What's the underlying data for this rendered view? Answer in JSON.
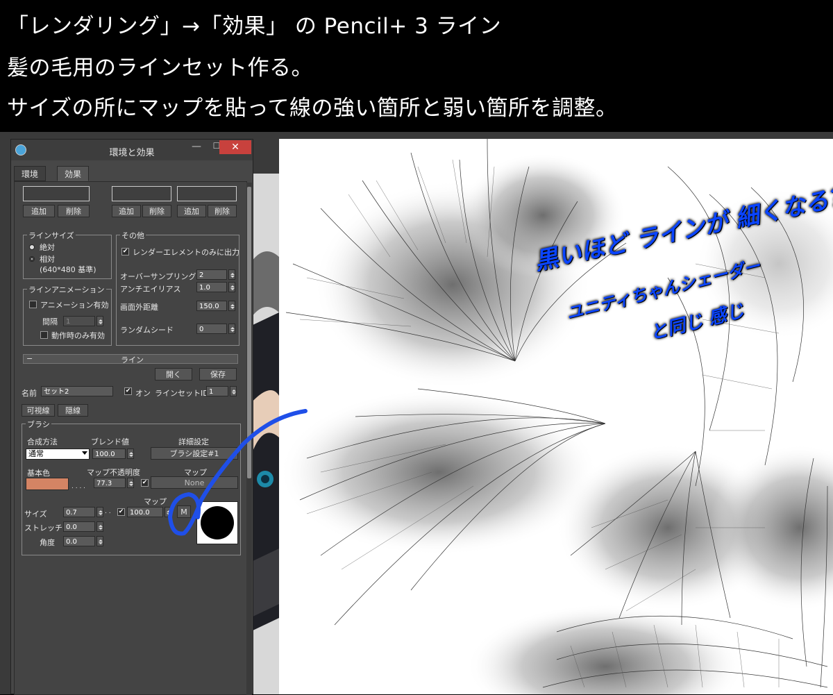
{
  "banner": {
    "line1": "「レンダリング」→「効果」 の Pencil+ 3 ライン",
    "line2": "髪の毛用のラインセット作る。",
    "line3": "サイズの所にマップを貼って線の強い箇所と弱い箇所を調整。"
  },
  "dialog": {
    "title": "環境と効果",
    "tabs": [
      "環境",
      "効果"
    ],
    "effects_list": {
      "add_label": "追加",
      "delete_label": "削除"
    },
    "line_size": {
      "group_label": "ラインサイズ",
      "absolute": "絶対",
      "relative": "相対",
      "relative_note": "(640*480 基準)"
    },
    "other": {
      "group_label": "その他",
      "render_element_only": "レンダーエレメントのみに出力",
      "oversampling_label": "オーバーサンプリング",
      "oversampling_value": "2",
      "antialias_label": "アンチエイリアス",
      "antialias_value": "1.0",
      "offscreen_label": "画面外距離",
      "offscreen_value": "150.0",
      "random_seed_label": "ランダムシード",
      "random_seed_value": "0"
    },
    "line_animation": {
      "group_label": "ラインアニメーション",
      "animation_enabled": "アニメーション有効",
      "interval_label": "間隔",
      "interval_value": "1",
      "only_when_moving": "動作時のみ有効"
    },
    "line_rollout": {
      "title": "ライン",
      "collapse": "−",
      "open_label": "開く",
      "save_label": "保存",
      "name_label": "名前",
      "name_value": "セット2",
      "on_label": "オン",
      "lineset_id_label": "ラインセットID",
      "lineset_id_value": "1",
      "visible_tab": "可視線",
      "hidden_tab": "隠線"
    },
    "brush": {
      "group_label": "ブラシ",
      "blend_mode_label": "合成方法",
      "blend_mode_value": "通常",
      "blend_value_label": "ブレンド値",
      "blend_value": "100.0",
      "detail_label": "詳細設定",
      "brush_setting_label": "ブラシ設定#1",
      "base_color_label": "基本色",
      "base_color": "#d48464",
      "map_opacity_label": "マップ不透明度",
      "map_opacity_value": "77.3",
      "map_label": "マップ",
      "map_value": "None",
      "dots": ". . . .",
      "size_map_label": "マップ",
      "size_label": "サイズ",
      "size_value": "0.7",
      "size_dots": ". .",
      "size_map_amount": "100.0",
      "m_button": "M",
      "stretch_label": "ストレッチ",
      "stretch_value": "0.0",
      "angle_label": "角度",
      "angle_value": "0.0"
    }
  },
  "annotations": {
    "note1": "黒いほど ラインが 細くなる？",
    "note2": "ユニティちゃんシェーダー",
    "note3": "と同じ 感じ"
  },
  "colors": {
    "annotation_blue": "#0a44ff",
    "close_button": "#c8413d",
    "dialog_bg": "#474747"
  }
}
